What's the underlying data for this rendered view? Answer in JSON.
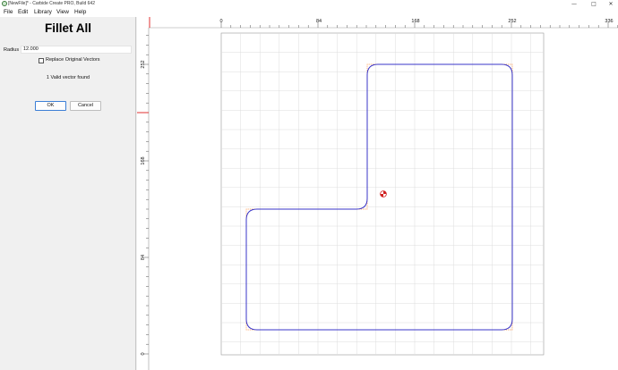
{
  "window": {
    "title": "[NewFile]* - Carbide Create PRO, Build 642",
    "controls": {
      "minimize": "—",
      "maximize": "□",
      "close": "✕"
    }
  },
  "menu": {
    "items": [
      "File",
      "Edit",
      "Library",
      "View",
      "Help"
    ]
  },
  "panel": {
    "title": "Fillet All",
    "radius_label": "Radius",
    "radius_value": "12.000",
    "replace_label": "Replace Original Vectors",
    "replace_checked": false,
    "status": "1 Valid vector found",
    "ok_label": "OK",
    "cancel_label": "Cancel"
  },
  "canvas": {
    "top_ruler_labels": [
      "0",
      "84",
      "168",
      "252",
      "336"
    ],
    "left_ruler_labels": [
      "0",
      "84",
      "168",
      "252"
    ],
    "colors": {
      "vector": "#3a36c8",
      "highlight": "#ff8a3a",
      "ruler_marker": "#e03030",
      "grid": "#dcdcdc"
    }
  }
}
